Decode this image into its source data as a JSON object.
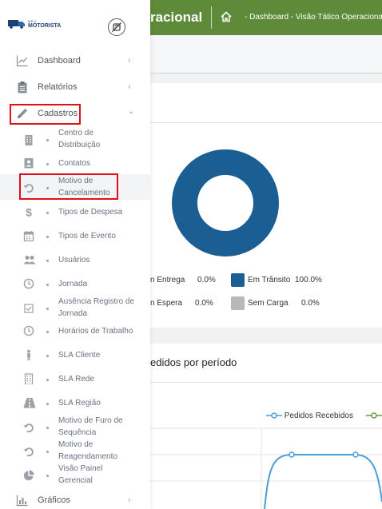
{
  "header": {
    "title": "racional",
    "breadcrumb": "- Dashboard - Visão Tático Operacional"
  },
  "logo": {
    "small": "MEU",
    "main": "MOTORISTA"
  },
  "sidebar": {
    "main_items": [
      {
        "label": "Dashboard",
        "chevron": "›"
      },
      {
        "label": "Relatórios",
        "chevron": "›"
      },
      {
        "label": "Cadastros",
        "chevron": "⌄"
      },
      {
        "label": "Gráficos",
        "chevron": "›"
      }
    ],
    "sub_items": [
      {
        "label": "Centro de Distribuição"
      },
      {
        "label": "Contatos"
      },
      {
        "label": "Motivo de Cancelamento"
      },
      {
        "label": "Tipos de Despesa"
      },
      {
        "label": "Tipos de Evento"
      },
      {
        "label": "Usuários"
      },
      {
        "label": "Jornada"
      },
      {
        "label": "Ausência Registro de Jornada"
      },
      {
        "label": "Horários de Trabalho"
      },
      {
        "label": "SLA Cliente"
      },
      {
        "label": "SLA Rede"
      },
      {
        "label": "SLA Região"
      },
      {
        "label": "Motivo de Furo de Sequência"
      },
      {
        "label": "Motivo de Reagendamento"
      },
      {
        "label": "Visão Painel Gerencial"
      }
    ]
  },
  "status_chart": {
    "legend": [
      {
        "label": "n Entrega",
        "value": "0.0%"
      },
      {
        "label": "Em Trânsito",
        "value": "100.0%",
        "color": "#1b5e94"
      },
      {
        "label": "n Espera",
        "value": "0.0%"
      },
      {
        "label": "Sem Carga",
        "value": "0.0%",
        "color": "#b8b8b8"
      }
    ]
  },
  "period_chart": {
    "title": "edidos por período",
    "legend": [
      {
        "label": "Pedidos Recebidos",
        "color": "#4a9fd8"
      },
      {
        "label": "",
        "color": "#6a9a3a"
      }
    ]
  },
  "chart_data": [
    {
      "type": "pie",
      "categories": [
        "Em Entrega",
        "Em Trânsito",
        "Em Espera",
        "Sem Carga"
      ],
      "values": [
        0.0,
        100.0,
        0.0,
        0.0
      ]
    },
    {
      "type": "line",
      "title": "Pedidos por período",
      "series": [
        {
          "name": "Pedidos Recebidos"
        }
      ]
    }
  ],
  "colors": {
    "header": "#5e8a3a",
    "highlight": "#e0101a",
    "donut": "#1b5e94"
  }
}
